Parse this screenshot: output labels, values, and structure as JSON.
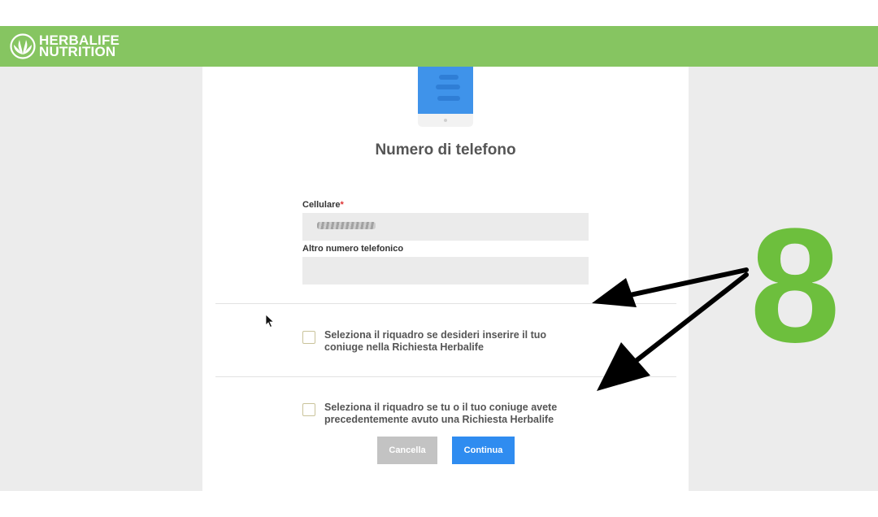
{
  "brand": {
    "line1": "HERBALIFE",
    "line2": "NUTRITION",
    "header_color": "#86c561",
    "logo_icon": "herbalife-leaf-icon"
  },
  "form": {
    "title": "Numero di telefono",
    "phone_illustration": "phone-illustration-icon",
    "cellulare_label": "Cellulare",
    "required_mark": "*",
    "altro_label": "Altro numero telefonico",
    "checkbox1_text": "Seleziona il riquadro se desideri inserire il tuo coniuge nella Richiesta Herbalife",
    "checkbox1_checked": false,
    "checkbox2_text": "Seleziona il riquadro se tu o il tuo coniuge avete precedentemente avuto una Richiesta Herbalife",
    "checkbox2_checked": false,
    "cancel_label": "Cancella",
    "continue_label": "Continua",
    "continue_color": "#2f8cf0"
  },
  "annotation": {
    "number": "8",
    "color": "#6dbf3d",
    "arrow_icon": "black-arrow-icon"
  }
}
